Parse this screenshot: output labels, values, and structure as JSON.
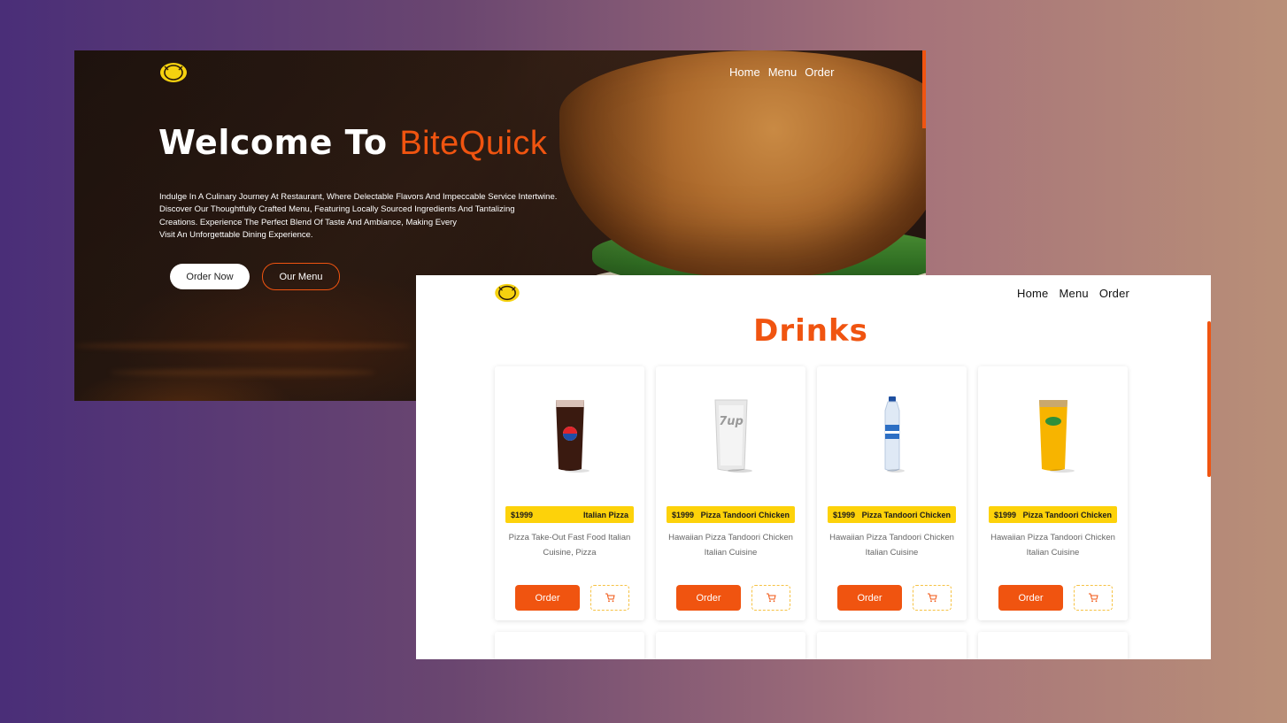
{
  "hero": {
    "nav": [
      "Home",
      "Menu",
      "Order"
    ],
    "title_prefix": "Welcome To ",
    "title_brand": "BiteQuick",
    "description": [
      "Indulge In A Culinary Journey At Restaurant, Where Delectable Flavors And Impeccable Service Intertwine.",
      "Discover Our Thoughtfully Crafted Menu, Featuring Locally Sourced Ingredients And Tantalizing",
      "Creations. Experience The Perfect Blend Of Taste And Ambiance, Making Every",
      "Visit An Unforgettable Dining Experience."
    ],
    "order_now_label": "Order Now",
    "our_menu_label": "Our Menu"
  },
  "drinks_page": {
    "nav": [
      "Home",
      "Menu",
      "Order"
    ],
    "title": "Drinks",
    "cards": [
      {
        "image": "pepsi-glass",
        "price": "$1999",
        "name": "Italian Pizza",
        "desc_line1": "Pizza Take-Out Fast Food Italian",
        "desc_line2": "Cuisine, Pizza",
        "order_label": "Order"
      },
      {
        "image": "7up-glass",
        "price": "$1999",
        "name": "Pizza Tandoori Chicken",
        "desc_line1": "Hawaiian Pizza Tandoori Chicken",
        "desc_line2": "Italian Cuisine",
        "order_label": "Order"
      },
      {
        "image": "water-bottle",
        "price": "$1999",
        "name": "Pizza Tandoori Chicken",
        "desc_line1": "Hawaiian Pizza Tandoori Chicken",
        "desc_line2": "Italian Cuisine",
        "order_label": "Order"
      },
      {
        "image": "mirinda-glass",
        "price": "$1999",
        "name": "Pizza Tandoori Chicken",
        "desc_line1": "Hawaiian Pizza Tandoori Chicken",
        "desc_line2": "Italian Cuisine",
        "order_label": "Order"
      }
    ]
  },
  "colors": {
    "accent": "#f05410",
    "tag": "#fdd20a",
    "logo": "#f6d20f"
  }
}
